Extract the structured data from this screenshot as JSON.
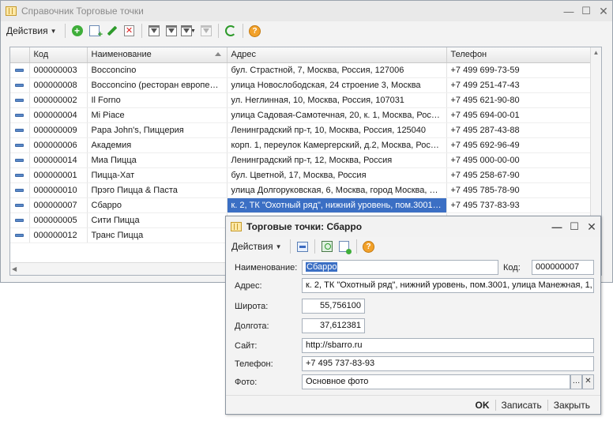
{
  "main_window": {
    "title": "Справочник Торговые точки",
    "toolbar": {
      "actions_label": "Действия"
    },
    "table": {
      "columns": [
        "Код",
        "Наименование",
        "Адрес",
        "Телефон"
      ],
      "rows": [
        {
          "code": "000000003",
          "name": "Bocconcino",
          "address": "бул. Страстной, 7, Москва, Россия, 127006",
          "phone": "+7 499 699-73-59"
        },
        {
          "code": "000000008",
          "name": "Bocconcino (ресторан европей…",
          "address": "улица Новослободская, 24 строение 3, Москва",
          "phone": "+7 499 251-47-43"
        },
        {
          "code": "000000002",
          "name": "Il Forno",
          "address": "ул. Неглинная, 10, Москва, Россия, 107031",
          "phone": "+7 495 621-90-80"
        },
        {
          "code": "000000004",
          "name": "Mi Piace",
          "address": "улица Садовая-Самотечная, 20, к. 1, Москва, Россия",
          "phone": "+7 495 694-00-01"
        },
        {
          "code": "000000009",
          "name": "Papa John's, Пиццерия",
          "address": "Ленинградский пр-т, 10, Москва, Россия, 125040",
          "phone": "+7 495 287-43-88"
        },
        {
          "code": "000000006",
          "name": "Академия",
          "address": "корп. 1, переулок Камергерский, д.2, Москва, Рос…",
          "phone": "+7 495 692-96-49"
        },
        {
          "code": "000000014",
          "name": "Миа Пицца",
          "address": "Ленинградский пр-т, 12, Москва, Россия",
          "phone": "+7 495 000-00-00"
        },
        {
          "code": "000000001",
          "name": "Пицца-Хат",
          "address": "бул. Цветной, 17, Москва, Россия",
          "phone": "+7 495 258-67-90"
        },
        {
          "code": "000000010",
          "name": "Прэго Пицца & Паста",
          "address": "улица Долгоруковская, 6, Москва, город Москва, …",
          "phone": "+7 495 785-78-90"
        },
        {
          "code": "000000007",
          "name": "Сбарро",
          "address": "к. 2, ТК \"Охотный ряд\", нижний уровень, пом.3001…",
          "phone": "+7 495 737-83-93"
        },
        {
          "code": "000000005",
          "name": "Сити Пицца",
          "address": "",
          "phone": ""
        },
        {
          "code": "000000012",
          "name": "Транс Пицца",
          "address": "",
          "phone": ""
        }
      ]
    }
  },
  "dialog": {
    "title": "Торговые точки: Сбарро",
    "toolbar": {
      "actions_label": "Действия"
    },
    "fields": {
      "name_label": "Наименование:",
      "name_value": "Сбарро",
      "code_label": "Код:",
      "code_value": "000000007",
      "address_label": "Адрес:",
      "address_value": "к. 2, ТК \"Охотный ряд\", нижний уровень, пом.3001, улица Манежная, 1,",
      "lat_label": "Широта:",
      "lat_value": "55,756100",
      "lon_label": "Долгота:",
      "lon_value": "37,612381",
      "site_label": "Сайт:",
      "site_value": "http://sbarro.ru",
      "phone_label": "Телефон:",
      "phone_value": "+7 495 737-83-93",
      "photo_label": "Фото:",
      "photo_value": "Основное фото"
    },
    "buttons": {
      "ok": "OK",
      "save": "Записать",
      "close": "Закрыть"
    }
  }
}
